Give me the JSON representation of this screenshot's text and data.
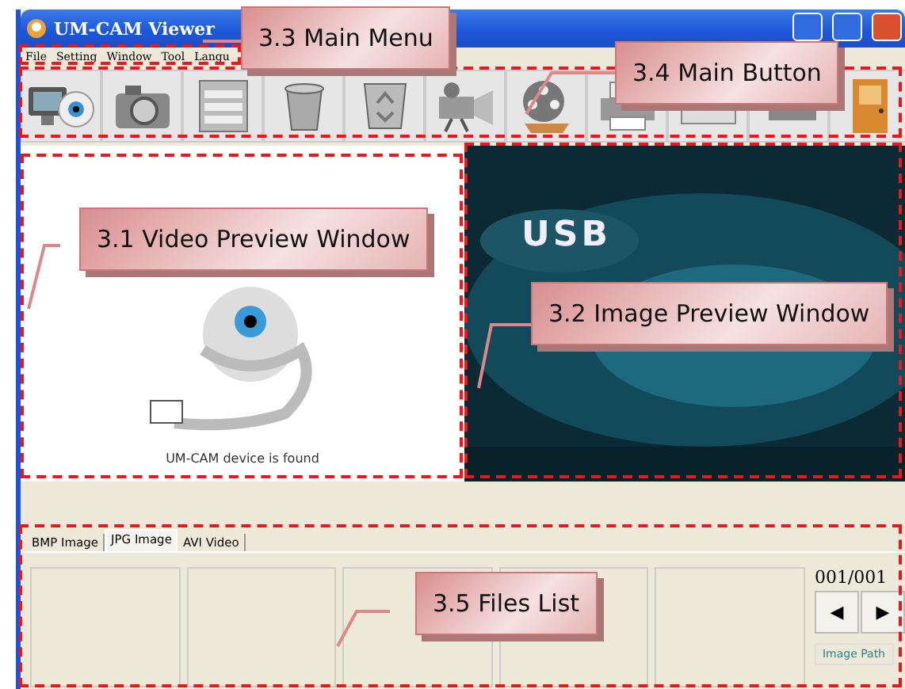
{
  "window": {
    "title": "UM-CAM Viewer"
  },
  "menu": [
    {
      "label": "File"
    },
    {
      "label": "Setting"
    },
    {
      "label": "Window"
    },
    {
      "label": "Tool"
    },
    {
      "label": "Langu"
    }
  ],
  "toolbar": [
    {
      "kind": "webcam"
    },
    {
      "kind": "camera"
    },
    {
      "kind": "drawer"
    },
    {
      "kind": "bin"
    },
    {
      "kind": "recycle"
    },
    {
      "kind": "projector"
    },
    {
      "kind": "reel"
    },
    {
      "kind": "printer"
    },
    {
      "kind": "envelope"
    },
    {
      "kind": "books"
    },
    {
      "kind": "door"
    }
  ],
  "video_preview": {
    "caption": "UM-CAM device is found"
  },
  "image_preview": {
    "texts": [
      "USB"
    ]
  },
  "tabs": [
    {
      "label": "BMP Image",
      "selected": false
    },
    {
      "label": "JPG Image",
      "selected": true
    },
    {
      "label": "AVI Video",
      "selected": false
    }
  ],
  "files_list": {
    "counter": "001/001",
    "prev": "◀",
    "next": "▶",
    "path_button": "Image Path"
  },
  "annotations": [
    {
      "label": "3.3 Main Menu"
    },
    {
      "label": "3.4 Main Button"
    },
    {
      "label": "3.1 Video Preview Window"
    },
    {
      "label": "3.2 Image Preview Window"
    },
    {
      "label": "3.5 Files List"
    }
  ]
}
